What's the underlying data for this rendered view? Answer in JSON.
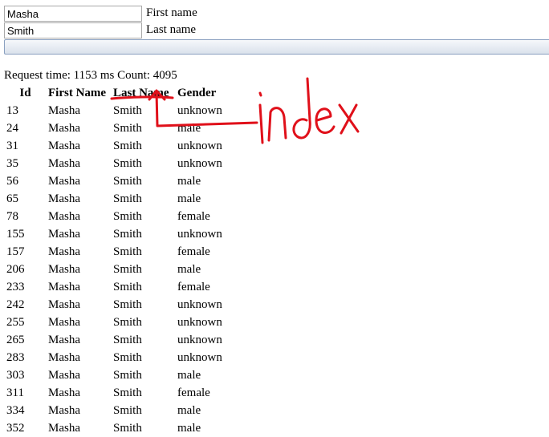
{
  "form": {
    "first_name": {
      "value": "Masha",
      "label": "First name"
    },
    "last_name": {
      "value": "Smith",
      "label": "Last name"
    },
    "submit_label": ""
  },
  "request_info": "Request time: 1153 ms Count: 4095",
  "table": {
    "headers": [
      "Id",
      "First Name",
      "Last Name",
      "Gender"
    ],
    "rows": [
      [
        "13",
        "Masha",
        "Smith",
        "unknown"
      ],
      [
        "24",
        "Masha",
        "Smith",
        "male"
      ],
      [
        "31",
        "Masha",
        "Smith",
        "unknown"
      ],
      [
        "35",
        "Masha",
        "Smith",
        "unknown"
      ],
      [
        "56",
        "Masha",
        "Smith",
        "male"
      ],
      [
        "65",
        "Masha",
        "Smith",
        "male"
      ],
      [
        "78",
        "Masha",
        "Smith",
        "female"
      ],
      [
        "155",
        "Masha",
        "Smith",
        "unknown"
      ],
      [
        "157",
        "Masha",
        "Smith",
        "female"
      ],
      [
        "206",
        "Masha",
        "Smith",
        "male"
      ],
      [
        "233",
        "Masha",
        "Smith",
        "female"
      ],
      [
        "242",
        "Masha",
        "Smith",
        "unknown"
      ],
      [
        "255",
        "Masha",
        "Smith",
        "unknown"
      ],
      [
        "265",
        "Masha",
        "Smith",
        "unknown"
      ],
      [
        "283",
        "Masha",
        "Smith",
        "unknown"
      ],
      [
        "303",
        "Masha",
        "Smith",
        "male"
      ],
      [
        "311",
        "Masha",
        "Smith",
        "female"
      ],
      [
        "334",
        "Masha",
        "Smith",
        "male"
      ],
      [
        "352",
        "Masha",
        "Smith",
        "male"
      ]
    ]
  },
  "annotation": {
    "text": "index",
    "color": "#e0101a"
  }
}
